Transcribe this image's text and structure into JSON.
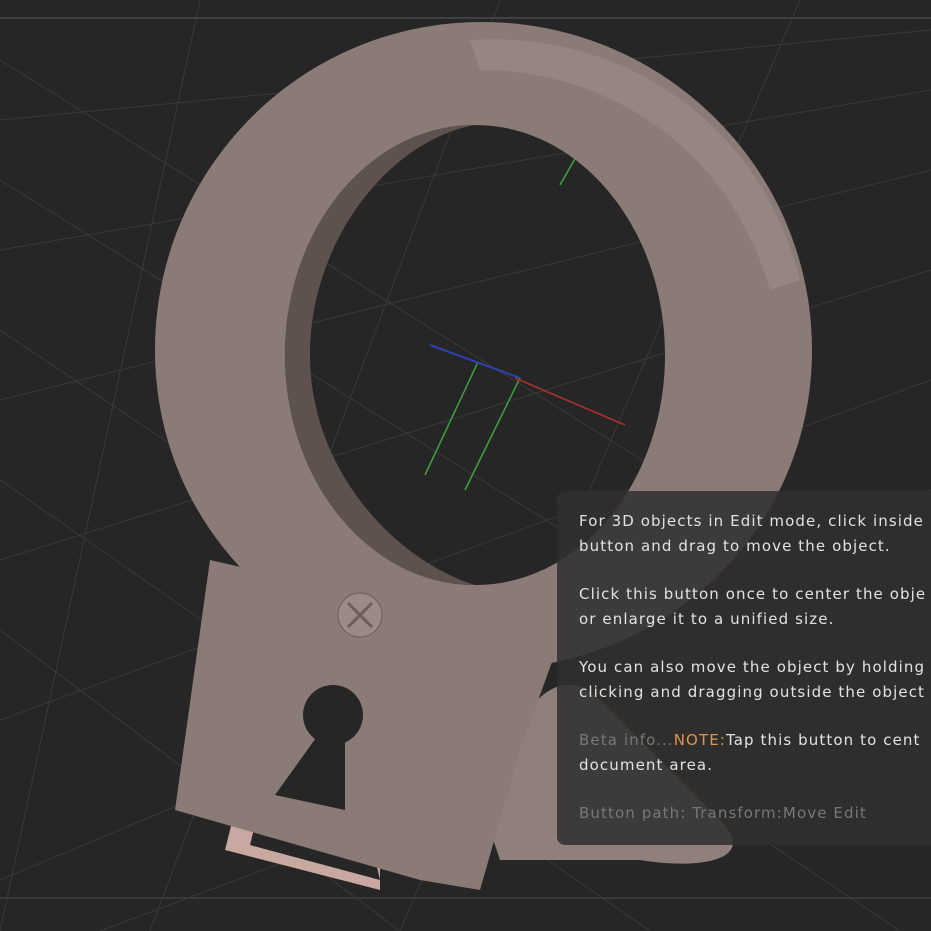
{
  "tooltip": {
    "para1_line1": "For 3D objects in Edit mode, click inside",
    "para1_line2": "button and drag to move the object.",
    "para2_line1": "Click this button once to center the obje",
    "para2_line2": "or enlarge it to a unified size.",
    "para3_line1": "You can also move the object by holding",
    "para3_line2": "clicking and dragging outside the object",
    "beta_prefix": "Beta info...",
    "note_label": "NOTE:",
    "beta_line1": "Tap this button to cent",
    "beta_line2": "document area.",
    "button_path": "Button path: Transform:Move Edit"
  },
  "colors": {
    "background": "#262626",
    "model": "#8a7b77",
    "note": "#e0954a"
  }
}
